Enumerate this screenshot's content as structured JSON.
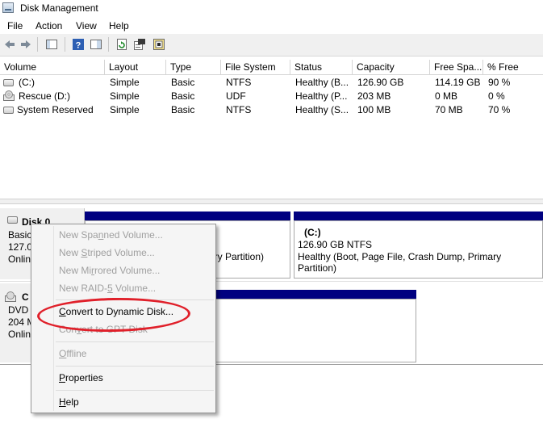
{
  "window": {
    "title": "Disk Management"
  },
  "menu": [
    "File",
    "Action",
    "View",
    "Help"
  ],
  "toolbar": {
    "icons": [
      "back-arrow-icon",
      "forward-arrow-icon",
      "console-tree-icon",
      "help-icon",
      "show-hide-icon",
      "refresh-icon",
      "properties-icon",
      "rescan-icon"
    ]
  },
  "volume_list": {
    "columns": [
      "Volume",
      "Layout",
      "Type",
      "File System",
      "Status",
      "Capacity",
      "Free Spa...",
      "% Free"
    ],
    "rows": [
      [
        "(C:)",
        "Simple",
        "Basic",
        "NTFS",
        "Healthy (B...",
        "126.90 GB",
        "114.19 GB",
        "90 %"
      ],
      [
        "Rescue (D:)",
        "Simple",
        "Basic",
        "UDF",
        "Healthy (P...",
        "203 MB",
        "0 MB",
        "0 %"
      ],
      [
        "System Reserved",
        "Simple",
        "Basic",
        "NTFS",
        "Healthy (S...",
        "100 MB",
        "70 MB",
        "70 %"
      ]
    ]
  },
  "graph": {
    "disk0": {
      "name": "Disk 0",
      "type": "Basic",
      "size": "127.0",
      "status": "Onlin",
      "partition_hidden_tail": "ary Partition)",
      "c_label": "(C:)",
      "c_size": "126.90 GB NTFS",
      "c_status": "Healthy (Boot, Page File, Crash Dump, Primary Partition)"
    },
    "cdrom0": {
      "name": "C",
      "type": "DVD",
      "size": "204 M",
      "status": "Onlin"
    }
  },
  "context_menu": {
    "items": [
      {
        "pre": "New Spa",
        "ul": "n",
        "post": "ned Volume...",
        "enabled": false
      },
      {
        "pre": "New ",
        "ul": "S",
        "post": "triped Volume...",
        "enabled": false
      },
      {
        "pre": "New Mi",
        "ul": "r",
        "post": "rored Volume...",
        "enabled": false
      },
      {
        "pre": "New RAID-",
        "ul": "5",
        "post": " Volume...",
        "enabled": false
      },
      {
        "pre": "",
        "ul": "C",
        "post": "onvert to Dynamic Disk...",
        "enabled": true
      },
      {
        "pre": "Con",
        "ul": "v",
        "post": "ert to GPT Disk",
        "enabled": false
      },
      {
        "pre": "",
        "ul": "O",
        "post": "ffline",
        "enabled": false
      },
      {
        "pre": "",
        "ul": "P",
        "post": "roperties",
        "enabled": true
      },
      {
        "pre": "",
        "ul": "H",
        "post": "elp",
        "enabled": true
      }
    ]
  },
  "colors": {
    "volume_bar": "#000080",
    "highlight_ellipse": "#e0202a"
  }
}
